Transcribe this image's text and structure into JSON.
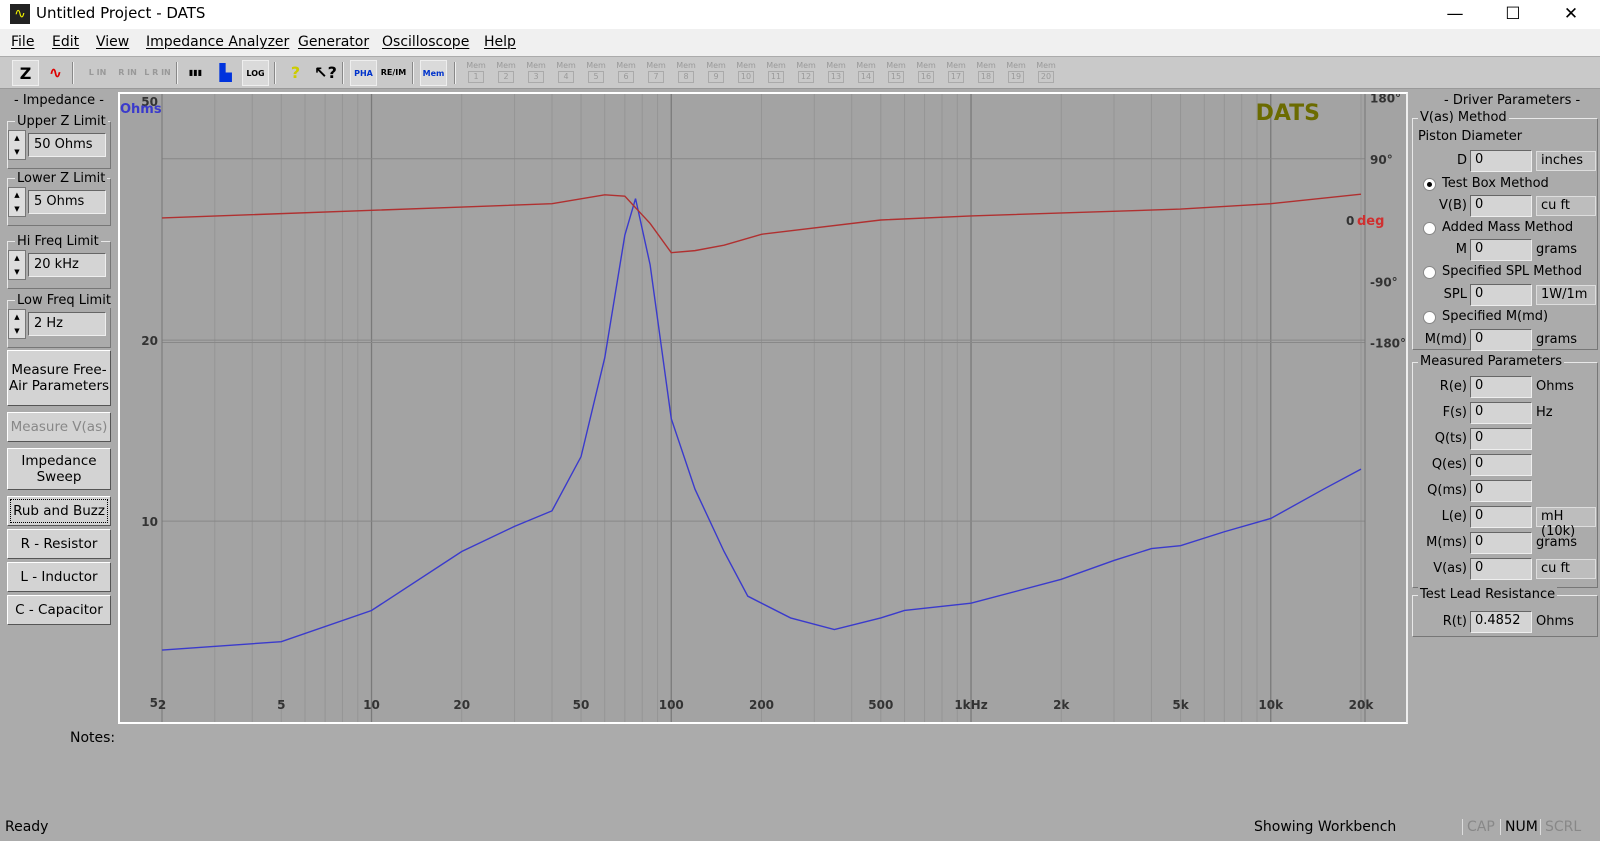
{
  "window": {
    "title": "Untitled Project - DATS",
    "minimize": "—",
    "maximize": "☐",
    "close": "✕"
  },
  "menu": [
    "File",
    "Edit",
    "View",
    "Impedance Analyzer",
    "Generator",
    "Oscilloscope",
    "Help"
  ],
  "toolbar": {
    "buttons": [
      {
        "name": "impedance-z",
        "label": "Z"
      },
      {
        "name": "sine-wave",
        "label": "∿"
      },
      {
        "name": "left-in",
        "label": "L IN"
      },
      {
        "name": "right-in",
        "label": "R IN"
      },
      {
        "name": "lr-in",
        "label": "L R IN"
      },
      {
        "name": "piano",
        "label": "▮▮▮"
      },
      {
        "name": "bar-chart",
        "label": "▙"
      },
      {
        "name": "log-z",
        "label": "LOG Z"
      },
      {
        "name": "help",
        "label": "?"
      },
      {
        "name": "context-help",
        "label": "↖?"
      },
      {
        "name": "phase",
        "label": "PHA Φ"
      },
      {
        "name": "re-im",
        "label": "RE/IM"
      },
      {
        "name": "mem-w",
        "label": "Mem W"
      }
    ],
    "mem_buttons": [
      "1",
      "2",
      "3",
      "4",
      "5",
      "6",
      "7",
      "8",
      "9",
      "10",
      "11",
      "12",
      "13",
      "14",
      "15",
      "16",
      "17",
      "18",
      "19",
      "20"
    ],
    "mem_label": "Mem"
  },
  "left_panel": {
    "title": "- Impedance -",
    "limits": [
      {
        "label": "Upper Z Limit",
        "value": "50 Ohms"
      },
      {
        "label": "Lower Z Limit",
        "value": "5 Ohms"
      },
      {
        "label": "Hi Freq Limit",
        "value": "20 kHz"
      },
      {
        "label": "Low Freq Limit",
        "value": "2 Hz"
      }
    ],
    "buttons": [
      {
        "label": "Measure Free-Air Parameters",
        "disabled": false
      },
      {
        "label": "Measure V(as)",
        "disabled": true
      },
      {
        "label": "Impedance Sweep",
        "disabled": false
      },
      {
        "label": "Rub and Buzz",
        "disabled": false
      },
      {
        "label": "R - Resistor",
        "disabled": false
      },
      {
        "label": "L - Inductor",
        "disabled": false
      },
      {
        "label": "C - Capacitor",
        "disabled": false
      }
    ]
  },
  "chart_data": {
    "type": "line",
    "logo": "DATS",
    "x_ticks": [
      "2",
      "5",
      "10",
      "20",
      "50",
      "100",
      "200",
      "500",
      "1kHz",
      "2k",
      "5k",
      "10k",
      "20k"
    ],
    "x_tick_values": [
      2,
      5,
      10,
      20,
      50,
      100,
      200,
      500,
      1000,
      2000,
      5000,
      10000,
      20000
    ],
    "xlim": [
      2,
      20000
    ],
    "x_scale": "log",
    "y_label": "Ohms",
    "y_ticks": [
      "50",
      "20",
      "10",
      "5"
    ],
    "y_tick_values": [
      50,
      20,
      10,
      5
    ],
    "ylim": [
      5,
      50
    ],
    "y_scale": "log",
    "y2_label": "deg",
    "y2_ticks": [
      "180°",
      "90°",
      "0",
      "-90°",
      "-180°"
    ],
    "y2_tick_values": [
      180,
      90,
      0,
      -90,
      -180
    ],
    "y2lim": [
      -180,
      180
    ],
    "colors": {
      "impedance": "#3a3acc",
      "phase": "#b03030",
      "logo": "#6b6b00",
      "ohms_label": "#3a3acc",
      "deg_label": "#d03030"
    },
    "series": [
      {
        "key": "impedance",
        "x": [
          2,
          5,
          10,
          20,
          30,
          40,
          50,
          60,
          70,
          76,
          85,
          100,
          120,
          150,
          180,
          250,
          350,
          500,
          600,
          1000,
          2000,
          3000,
          4000,
          5000,
          7000,
          10000,
          15000,
          20000
        ],
        "y": [
          6.1,
          6.3,
          7.1,
          8.9,
          9.8,
          10.4,
          12.8,
          18.7,
          29.9,
          34.4,
          26.7,
          14.8,
          11.3,
          8.9,
          7.5,
          6.9,
          6.6,
          6.9,
          7.1,
          7.3,
          8.0,
          8.6,
          9.0,
          9.1,
          9.6,
          10.1,
          11.3,
          12.2
        ]
      },
      {
        "key": "phase",
        "x": [
          2,
          20,
          40,
          60,
          70,
          85,
          100,
          120,
          150,
          200,
          500,
          1000,
          5000,
          10000,
          20000
        ],
        "y": [
          3,
          19,
          24,
          37,
          35,
          -5,
          -48,
          -45,
          -37,
          -21,
          0,
          6,
          16,
          24,
          38
        ]
      }
    ]
  },
  "notes_label": "Notes:",
  "right_panel": {
    "title": "- Driver Parameters -",
    "vas_group": "V(as) Method",
    "piston": "Piston Diameter",
    "d": {
      "label": "D =",
      "value": "0",
      "unit": "inches"
    },
    "methods": [
      {
        "label": "Test Box Method",
        "selected": true,
        "field": {
          "label": "V(B) =",
          "value": "0",
          "unit": "cu ft"
        }
      },
      {
        "label": "Added Mass Method",
        "selected": false,
        "field": {
          "label": "M =",
          "value": "0",
          "unit": "grams"
        }
      },
      {
        "label": "Specified SPL Method",
        "selected": false,
        "field": {
          "label": "SPL =",
          "value": "0",
          "unit": "1W/1m"
        }
      },
      {
        "label": "Specified M(md)",
        "selected": false,
        "field": {
          "label": "M(md) =",
          "value": "0",
          "unit": "grams"
        }
      }
    ],
    "measured_group": "Measured Parameters",
    "measured": [
      {
        "label": "R(e) =",
        "value": "0",
        "unit": "Ohms"
      },
      {
        "label": "F(s) =",
        "value": "0",
        "unit": "Hz"
      },
      {
        "label": "Q(ts) =",
        "value": "0",
        "unit": ""
      },
      {
        "label": "Q(es) =",
        "value": "0",
        "unit": ""
      },
      {
        "label": "Q(ms) =",
        "value": "0",
        "unit": ""
      },
      {
        "label": "L(e) =",
        "value": "0",
        "unit": "mH (10k)"
      },
      {
        "label": "M(ms) =",
        "value": "0",
        "unit": "grams"
      },
      {
        "label": "V(as) =",
        "value": "0",
        "unit": "cu ft"
      }
    ],
    "lead_group": "Test Lead Resistance",
    "lead": {
      "label": "R(t) =",
      "value": "0.4852",
      "unit": "Ohms"
    }
  },
  "status": {
    "text": "Ready",
    "mode": "Showing Workbench",
    "cap": "CAP",
    "num": "NUM",
    "scrl": "SCRL"
  }
}
